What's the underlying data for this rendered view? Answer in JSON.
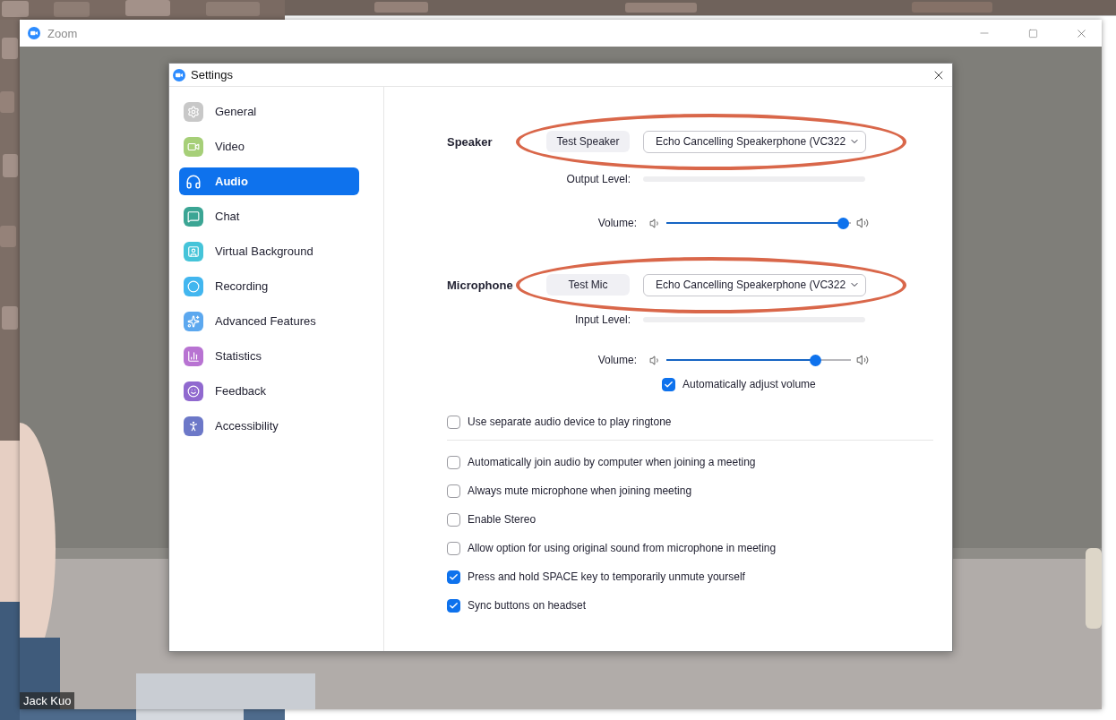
{
  "window": {
    "title": "Zoom"
  },
  "video": {
    "name_tag": "Jack Kuo"
  },
  "settings": {
    "title": "Settings",
    "nav": [
      {
        "label": "General",
        "selected": false,
        "color": "#c8c8c8"
      },
      {
        "label": "Video",
        "selected": false,
        "color": "#a6cf78"
      },
      {
        "label": "Audio",
        "selected": true
      },
      {
        "label": "Chat",
        "selected": false,
        "color": "#3ba594"
      },
      {
        "label": "Virtual Background",
        "selected": false,
        "color": "#45c4d9"
      },
      {
        "label": "Recording",
        "selected": false,
        "color": "#42b6ef"
      },
      {
        "label": "Advanced Features",
        "selected": false,
        "color": "#5ca8ef"
      },
      {
        "label": "Statistics",
        "selected": false,
        "color": "#b873d2"
      },
      {
        "label": "Feedback",
        "selected": false,
        "color": "#9069cf"
      },
      {
        "label": "Accessibility",
        "selected": false,
        "color": "#6c78c8"
      }
    ],
    "devices": [
      {
        "label": "Speaker",
        "test_button": "Test Speaker",
        "device": "Echo Cancelling Speakerphone (VC322",
        "highlighted": true,
        "level_label": "Output Level:",
        "level": 0,
        "volume_label": "Volume:",
        "volume": {
          "level": 0.96
        }
      },
      {
        "label": "Microphone",
        "test_button": "Test Mic",
        "device": "Echo Cancelling Speakerphone (VC322",
        "highlighted": true,
        "level_label": "Input Level:",
        "level": 0,
        "volume_label": "Volume:",
        "volume": {
          "level": 0.81
        }
      }
    ],
    "auto_adjust": {
      "label": "Automatically adjust volume",
      "checked": true
    },
    "ringtone": {
      "label": "Use separate audio device to play ringtone",
      "checked": false
    },
    "options": [
      {
        "label": "Automatically join audio by computer when joining a meeting",
        "checked": false
      },
      {
        "label": "Always mute microphone when joining meeting",
        "checked": false
      },
      {
        "label": "Enable Stereo",
        "checked": false
      },
      {
        "label": "Allow option for using original sound from microphone in meeting",
        "checked": false
      },
      {
        "label": "Press and hold SPACE key to temporarily unmute yourself",
        "checked": true
      },
      {
        "label": "Sync buttons on headset",
        "checked": true
      }
    ]
  }
}
